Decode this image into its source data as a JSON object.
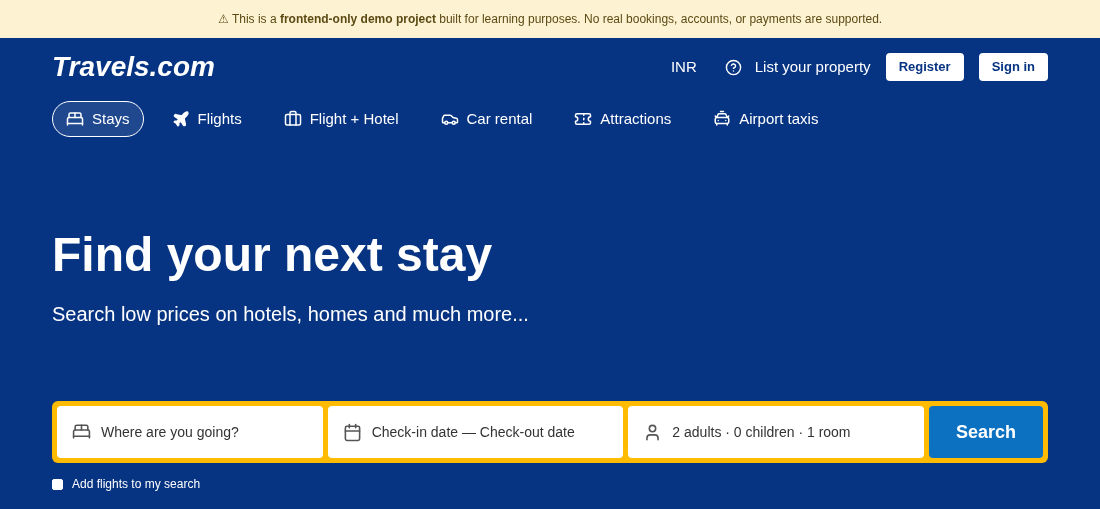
{
  "notice": {
    "icon": "⚠",
    "text": "This is a **frontend-only demo project** built for learning purposes. No real bookings, accounts, or payments are supported."
  },
  "header": {
    "logo": "Travels.com",
    "currency": "INR",
    "list_property": "List your property",
    "buttons": [
      {
        "label": "Register"
      },
      {
        "label": "Sign in"
      }
    ]
  },
  "nav": [
    {
      "kind": "bed",
      "label": "Stays",
      "selected": true
    },
    {
      "kind": "plane",
      "label": "Flights",
      "selected": false
    },
    {
      "kind": "suitcase",
      "label": "Flight + Hotel",
      "selected": false
    },
    {
      "kind": "car",
      "label": "Car rental",
      "selected": false
    },
    {
      "kind": "ticket",
      "label": "Attractions",
      "selected": false
    },
    {
      "kind": "taxi",
      "label": "Airport taxis",
      "selected": false
    }
  ],
  "hero": {
    "title": "Find your next stay",
    "subtitle": "Search low prices on hotels, homes and much more..."
  },
  "search": {
    "fields": [
      {
        "kind": "bed",
        "placeholder": "Where are you going?"
      },
      {
        "kind": "calendar",
        "text": "Check-in date — Check-out date"
      },
      {
        "kind": "person",
        "text": "2 adults · 0 children · 1 room"
      }
    ],
    "button": "Search",
    "flights_option": {
      "label": "Add flights to my search",
      "checked": false
    }
  }
}
